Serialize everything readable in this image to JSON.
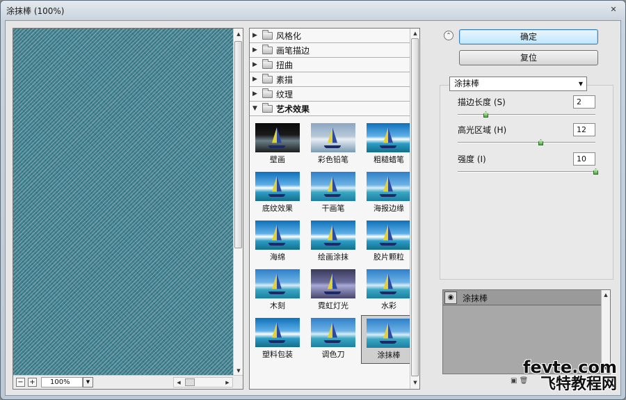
{
  "window": {
    "title": "涂抹棒 (100%)"
  },
  "preview": {
    "zoom": "100%",
    "zoom_minus": "−",
    "zoom_plus": "+"
  },
  "gallery": {
    "categories": [
      {
        "label": "风格化",
        "open": false
      },
      {
        "label": "画笔描边",
        "open": false
      },
      {
        "label": "扭曲",
        "open": false
      },
      {
        "label": "素描",
        "open": false
      },
      {
        "label": "纹理",
        "open": false
      },
      {
        "label": "艺术效果",
        "open": true
      }
    ],
    "thumbnails": [
      {
        "label": "壁画",
        "style": "dark"
      },
      {
        "label": "彩色铅笔",
        "style": "pastel"
      },
      {
        "label": "粗糙蜡笔",
        "style": "water"
      },
      {
        "label": "底纹效果",
        "style": "water"
      },
      {
        "label": "干画笔",
        "style": "normal"
      },
      {
        "label": "海报边缘",
        "style": "normal"
      },
      {
        "label": "海绵",
        "style": "water"
      },
      {
        "label": "绘画涂抹",
        "style": "water"
      },
      {
        "label": "胶片颗粒",
        "style": "water"
      },
      {
        "label": "木刻",
        "style": "normal"
      },
      {
        "label": "霓虹灯光",
        "style": "neon"
      },
      {
        "label": "水彩",
        "style": "normal"
      },
      {
        "label": "塑料包装",
        "style": "water"
      },
      {
        "label": "调色刀",
        "style": "normal"
      },
      {
        "label": "涂抹棒",
        "style": "normal",
        "selected": true
      }
    ]
  },
  "buttons": {
    "ok": "确定",
    "reset": "复位"
  },
  "filter": {
    "selected": "涂抹棒",
    "params": [
      {
        "label": "描边长度 (S)",
        "value": "2",
        "fraction": 0.2
      },
      {
        "label": "高光区域 (H)",
        "value": "12",
        "fraction": 0.6
      },
      {
        "label": "强度 (I)",
        "value": "10",
        "fraction": 1.0
      }
    ]
  },
  "layers": {
    "items": [
      {
        "name": "涂抹棒"
      }
    ]
  },
  "watermark": {
    "line1": "fevte.com",
    "line2": "飞特教程网"
  }
}
